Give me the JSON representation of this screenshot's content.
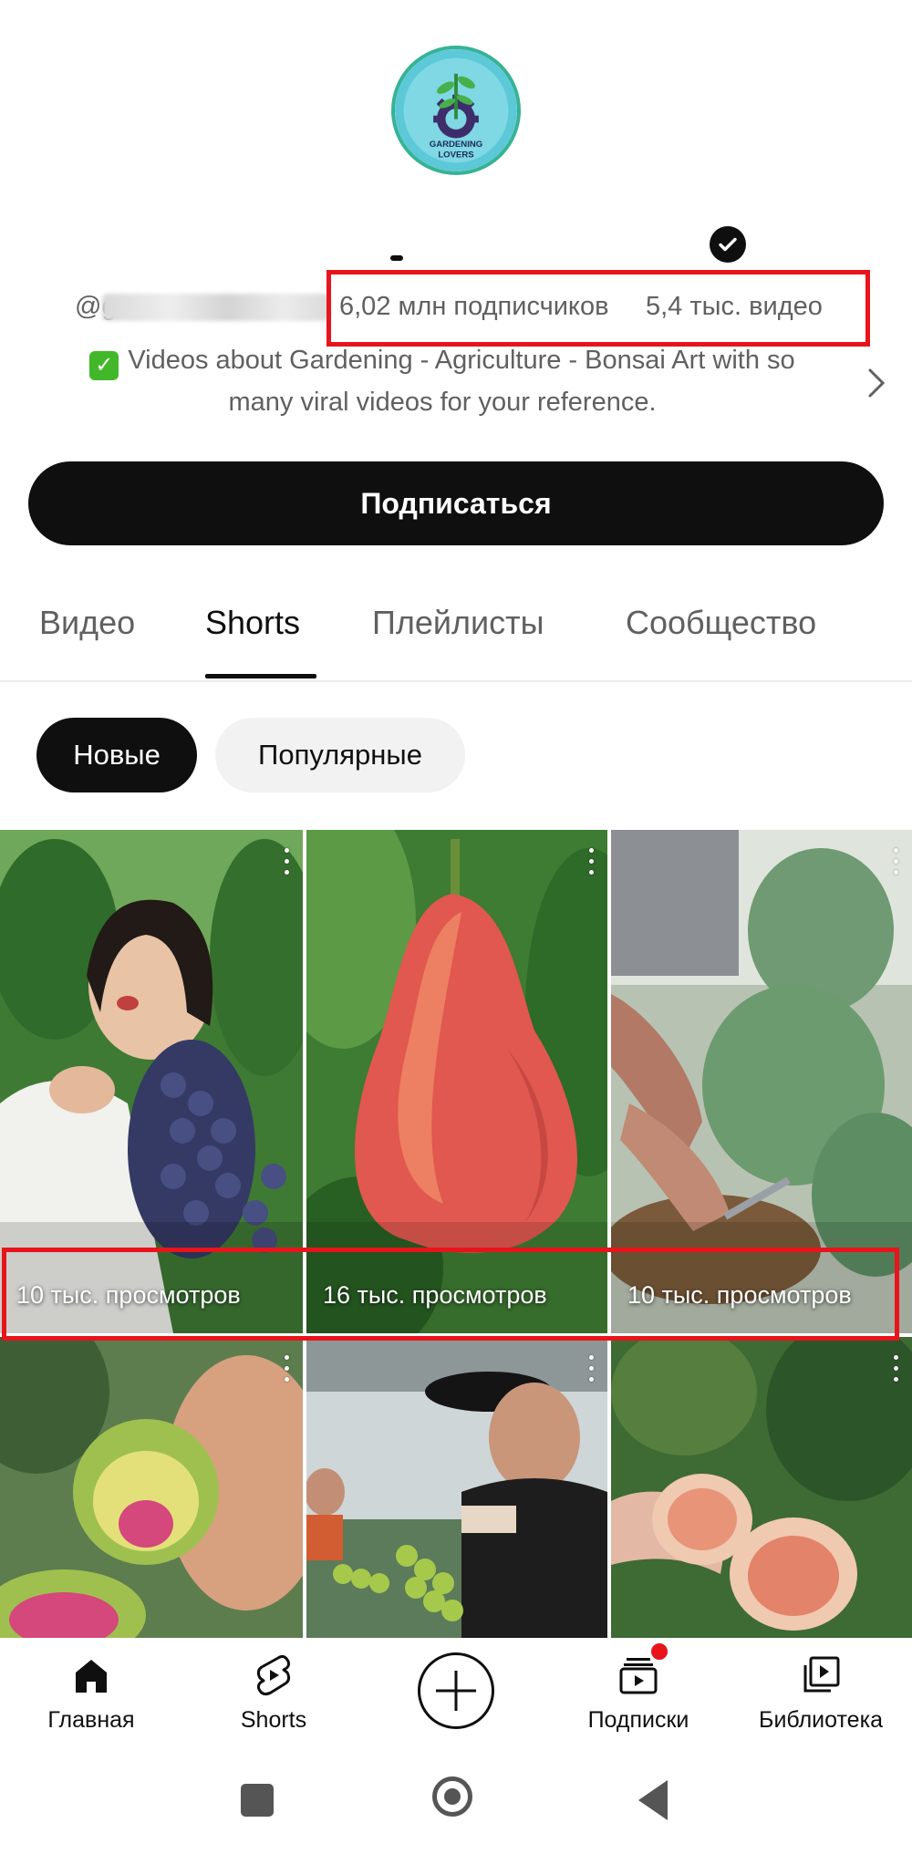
{
  "channel": {
    "avatar_text_line1": "GARDENING",
    "avatar_text_line2": "LOVERS",
    "handle": "@g",
    "subscribers": "6,02 млн подписчиков",
    "videos": "5,4 тыс. видео",
    "description_line1": "Videos about Gardening - Agriculture - Bonsai Art with so",
    "description_line2": "many viral videos for your reference.",
    "description_icon": "check-mark-emoji",
    "verified_icon": "verified-check-icon"
  },
  "subscribe_label": "Подписаться",
  "tabs": [
    {
      "label": "Видео"
    },
    {
      "label": "Shorts"
    },
    {
      "label": "Плейлисты"
    },
    {
      "label": "Сообщество"
    }
  ],
  "active_tab": "Shorts",
  "chips": [
    {
      "label": "Новые",
      "selected": true
    },
    {
      "label": "Популярные",
      "selected": false
    }
  ],
  "shorts": [
    {
      "views": "10 тыс. просмотров",
      "subject": "woman-with-grapes"
    },
    {
      "views": "16 тыс. просмотров",
      "subject": "red-pear"
    },
    {
      "views": "10 тыс. просмотров",
      "subject": "cactus-pads"
    },
    {
      "views": "",
      "subject": "prickly-pear-fruit"
    },
    {
      "views": "",
      "subject": "woman-with-green-grapes"
    },
    {
      "views": "",
      "subject": "fig-fruit"
    }
  ],
  "bottom_nav": [
    {
      "label": "Главная",
      "icon": "home-icon"
    },
    {
      "label": "Shorts",
      "icon": "shorts-icon"
    },
    {
      "label": "",
      "icon": "create-icon"
    },
    {
      "label": "Подписки",
      "icon": "subscriptions-icon"
    },
    {
      "label": "Библиотека",
      "icon": "library-icon"
    }
  ],
  "colors": {
    "highlight": "#e8141b",
    "primary": "#0f0f0f",
    "secondary_text": "#606060",
    "avatar_ring": "#36b394"
  }
}
